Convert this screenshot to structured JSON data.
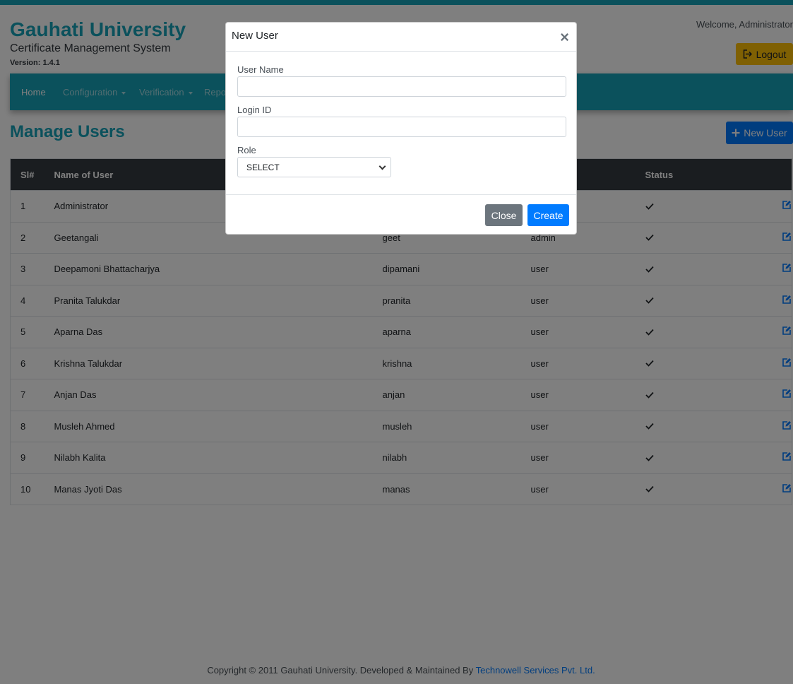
{
  "brand": {
    "title": "Gauhati University",
    "subtitle": "Certificate Management System",
    "version": "Version: 1.4.1"
  },
  "header": {
    "welcome": "Welcome, Administrator",
    "logout_label": "Logout"
  },
  "nav": {
    "items": [
      {
        "label": "Home"
      },
      {
        "label": "Configuration"
      },
      {
        "label": "Verification"
      },
      {
        "label": "Repo"
      }
    ]
  },
  "page": {
    "title": "Manage Users",
    "new_user_label": "New User"
  },
  "table": {
    "headers": [
      "Sl#",
      "Name of User",
      "",
      "",
      "Status",
      ""
    ],
    "rows": [
      {
        "sl": "1",
        "name": "Administrator",
        "login": "",
        "role": ""
      },
      {
        "sl": "2",
        "name": "Geetangali",
        "login": "geet",
        "role": "admin"
      },
      {
        "sl": "3",
        "name": "Deepamoni Bhattacharjya",
        "login": "dipamani",
        "role": "user"
      },
      {
        "sl": "4",
        "name": "Pranita Talukdar",
        "login": "pranita",
        "role": "user"
      },
      {
        "sl": "5",
        "name": "Aparna Das",
        "login": "aparna",
        "role": "user"
      },
      {
        "sl": "6",
        "name": "Krishna Talukdar",
        "login": "krishna",
        "role": "user"
      },
      {
        "sl": "7",
        "name": "Anjan Das",
        "login": "anjan",
        "role": "user"
      },
      {
        "sl": "8",
        "name": "Musleh Ahmed",
        "login": "musleh",
        "role": "user"
      },
      {
        "sl": "9",
        "name": "Nilabh Kalita",
        "login": "nilabh",
        "role": "user"
      },
      {
        "sl": "10",
        "name": "Manas Jyoti Das",
        "login": "manas",
        "role": "user"
      }
    ]
  },
  "footer": {
    "text": "Copyright © 2011 Gauhati University. Developed & Maintained By ",
    "link": "Technowell Services Pvt. Ltd."
  },
  "modal": {
    "title": "New User",
    "close_symbol": "×",
    "user_name_label": "User Name",
    "user_name_value": "",
    "login_id_label": "Login ID",
    "login_id_value": "",
    "role_label": "Role",
    "role_selected": "SELECT",
    "close_button": "Close",
    "create_button": "Create"
  },
  "colors": {
    "accent": "#17a2b8",
    "primary": "#007bff",
    "warning": "#ffc107",
    "dark": "#343a40",
    "secondary": "#6c757d"
  },
  "icons": [
    "logout-icon",
    "plus-icon",
    "check-icon",
    "edit-icon",
    "close-icon",
    "chevron-down-icon"
  ]
}
